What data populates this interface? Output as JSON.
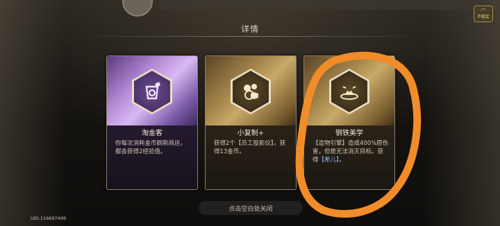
{
  "header": {
    "title": "详情"
  },
  "corner_button": {
    "label": "不稳定",
    "icon": "wifi-icon"
  },
  "cards": [
    {
      "name": "淘金客",
      "icon": "gold-panning-icon",
      "desc": "你每次消耗金币刷新商店，都会获得2经验值。"
    },
    {
      "name": "小复制+",
      "icon": "replicate-icon",
      "desc": "获得2个【员工投影仪】。获得13金币。"
    },
    {
      "name": "钢铁美学",
      "icon": "steel-aesthetics-icon",
      "desc_prefix": "【造物引擎】造成400%原伤害，但是无法消灭目标。获得",
      "desc_highlight": "【希儿】",
      "desc_suffix": "。"
    }
  ],
  "footer": {
    "close_hint": "点击空白处关闭",
    "uid": "UID:116697499"
  },
  "colors": {
    "annotation": "#f28c28",
    "highlight": "#8fb4ff",
    "gold": "#c9a967",
    "purple": "#b48ad6"
  }
}
